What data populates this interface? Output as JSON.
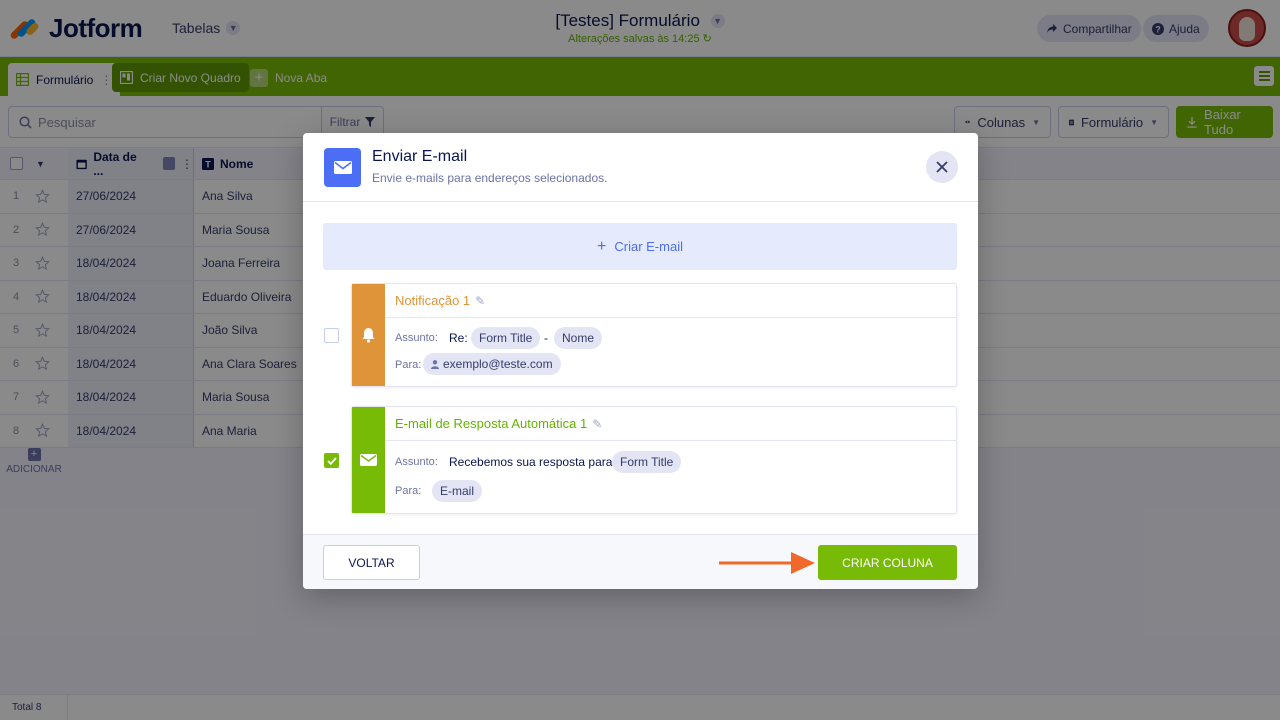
{
  "header": {
    "logo_text": "Jotform",
    "tables_label": "Tabelas",
    "form_title": "[Testes] Formulário",
    "saved_status": "Alterações salvas às 14:25",
    "share_label": "Compartilhar",
    "help_label": "Ajuda"
  },
  "tabs": {
    "form_tab": "Formulário",
    "create_board": "Criar Novo Quadro",
    "new_tab": "Nova Aba"
  },
  "toolbar": {
    "search_placeholder": "Pesquisar",
    "filter_label": "Filtrar",
    "columns_label": "Colunas",
    "form_view_label": "Formulário",
    "download_label": "Baixar Tudo"
  },
  "table": {
    "columns": [
      "Data de ...",
      "Nome"
    ],
    "rows": [
      {
        "num": "1",
        "date": "27/06/2024",
        "name": "Ana Silva"
      },
      {
        "num": "2",
        "date": "27/06/2024",
        "name": "Maria Sousa"
      },
      {
        "num": "3",
        "date": "18/04/2024",
        "name": "Joana Ferreira"
      },
      {
        "num": "4",
        "date": "18/04/2024",
        "name": "Eduardo Oliveira"
      },
      {
        "num": "5",
        "date": "18/04/2024",
        "name": "João Silva"
      },
      {
        "num": "6",
        "date": "18/04/2024",
        "name": "Ana Clara Soares"
      },
      {
        "num": "7",
        "date": "18/04/2024",
        "name": "Maria Sousa"
      },
      {
        "num": "8",
        "date": "18/04/2024",
        "name": "Ana Maria"
      }
    ],
    "add_label": "ADICIONAR",
    "total_label": "Total 8"
  },
  "modal": {
    "title": "Enviar E-mail",
    "subtitle": "Envie e-mails para endereços selecionados.",
    "create_email_label": "Criar E-mail",
    "notification": {
      "title": "Notificação 1",
      "subject_label": "Assunto:",
      "subject_prefix": "Re:",
      "subject_chip_1": "Form Title",
      "subject_separator": "-",
      "subject_chip_2": "Nome",
      "to_label": "Para:",
      "to_value": "exemplo@teste.com",
      "checked": false,
      "color": "#e09439"
    },
    "autoresponder": {
      "title": "E-mail de Resposta Automática 1",
      "subject_label": "Assunto:",
      "subject_text": "Recebemos sua resposta para",
      "subject_chip": "Form Title",
      "to_label": "Para:",
      "to_value": "E-mail",
      "checked": true,
      "color": "#78bb07"
    },
    "back_label": "VOLTAR",
    "create_column_label": "CRIAR COLUNA"
  },
  "colors": {
    "brand_green": "#78bb07",
    "accent_blue": "#4c6ef5",
    "annotation_arrow": "#f0692a"
  }
}
